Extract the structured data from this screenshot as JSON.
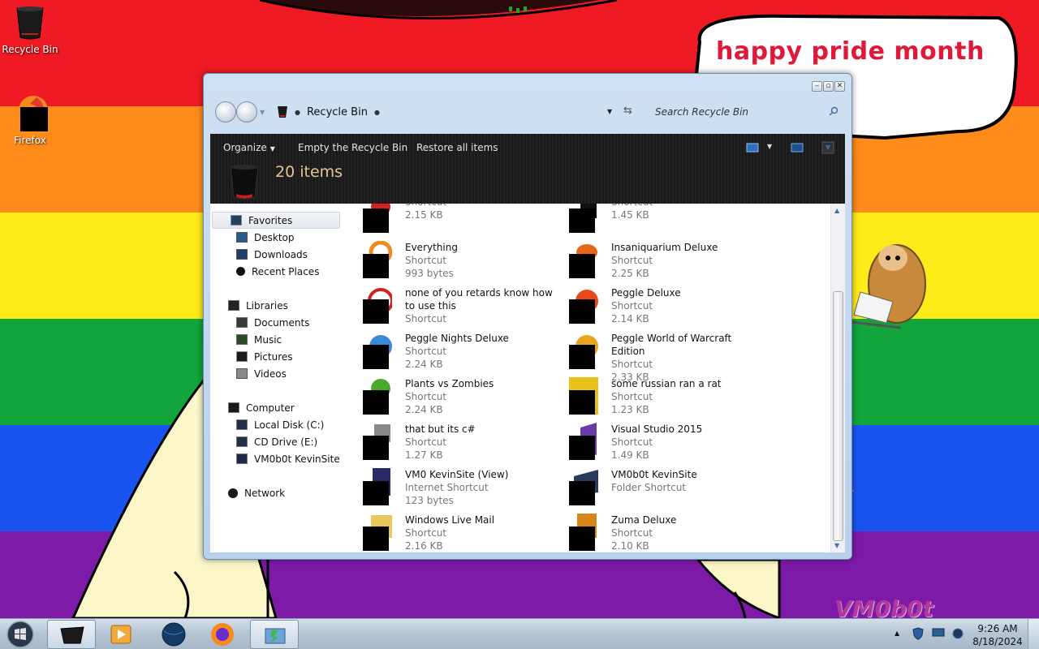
{
  "desktop": {
    "icons": [
      {
        "label": "Recycle Bin",
        "icon": "recycle-bin-icon"
      },
      {
        "label": "Firefox",
        "icon": "firefox-icon"
      }
    ],
    "speech_text": "happy pride month",
    "watermark": "VM0b0t"
  },
  "window": {
    "title_controls": [
      "minimize",
      "maximize",
      "close"
    ],
    "address": {
      "location": "Recycle Bin"
    },
    "search": {
      "placeholder": "Search Recycle Bin"
    },
    "toolbar": {
      "organize": "Organize",
      "empty": "Empty the Recycle Bin",
      "restore": "Restore all items"
    },
    "item_count": "20 items",
    "nav_pane": [
      {
        "label": "Favorites",
        "level": "top",
        "icon": "star-icon",
        "selected": true
      },
      {
        "label": "Desktop",
        "level": "sub",
        "icon": "desktop-icon"
      },
      {
        "label": "Downloads",
        "level": "sub",
        "icon": "downloads-icon"
      },
      {
        "label": "Recent Places",
        "level": "sub",
        "icon": "recent-places-icon"
      },
      {
        "label": "Libraries",
        "level": "top",
        "icon": "libraries-icon"
      },
      {
        "label": "Documents",
        "level": "sub",
        "icon": "documents-icon"
      },
      {
        "label": "Music",
        "level": "sub",
        "icon": "music-icon"
      },
      {
        "label": "Pictures",
        "level": "sub",
        "icon": "pictures-icon"
      },
      {
        "label": "Videos",
        "level": "sub",
        "icon": "videos-icon"
      },
      {
        "label": "Computer",
        "level": "top",
        "icon": "computer-icon"
      },
      {
        "label": "Local Disk (C:)",
        "level": "sub",
        "icon": "local-disk-icon"
      },
      {
        "label": "CD Drive (E:)",
        "level": "sub",
        "icon": "cd-drive-icon"
      },
      {
        "label": "VM0b0t KevinSite",
        "level": "sub",
        "icon": "folder-shortcut-icon"
      },
      {
        "label": "Network",
        "level": "top",
        "icon": "network-icon"
      }
    ],
    "files": [
      {
        "name": "",
        "type": "Shortcut",
        "size": "2.15 KB",
        "color": "#d42020"
      },
      {
        "name": "",
        "type": "Shortcut",
        "size": "1.45 KB",
        "color": "#111111"
      },
      {
        "name": "Everything",
        "type": "Shortcut",
        "size": "993 bytes",
        "color": "#f08a1a"
      },
      {
        "name": "Insaniquarium Deluxe",
        "type": "Shortcut",
        "size": "2.25 KB",
        "color": "#e8661a"
      },
      {
        "name": "none of you retards know how to use this",
        "type": "Shortcut",
        "size": "",
        "color": "#d42020"
      },
      {
        "name": "Peggle Deluxe",
        "type": "Shortcut",
        "size": "2.14 KB",
        "color": "#e84a1a"
      },
      {
        "name": "Peggle Nights Deluxe",
        "type": "Shortcut",
        "size": "2.24 KB",
        "color": "#3a8ad8"
      },
      {
        "name": "Peggle World of Warcraft Edition",
        "type": "Shortcut",
        "size": "2.33 KB",
        "color": "#e8a61a"
      },
      {
        "name": "Plants vs Zombies",
        "type": "Shortcut",
        "size": "2.24 KB",
        "color": "#4aa82a"
      },
      {
        "name": "some russian ran a rat",
        "type": "Shortcut",
        "size": "1.23 KB",
        "color": "#e8c21a"
      },
      {
        "name": "that but its c#",
        "type": "Shortcut",
        "size": "1.27 KB",
        "color": "#888888"
      },
      {
        "name": "Visual Studio 2015",
        "type": "Shortcut",
        "size": "1.49 KB",
        "color": "#6a3aa8"
      },
      {
        "name": "VM0 KevinSite (View)",
        "type": "Internet Shortcut",
        "size": "123 bytes",
        "color": "#2a2a6a"
      },
      {
        "name": "VM0b0t KevinSite",
        "type": "Folder Shortcut",
        "size": "",
        "color": "#2a3a5a"
      },
      {
        "name": "Windows Live Mail",
        "type": "Shortcut",
        "size": "2.16 KB",
        "color": "#e8c85a"
      },
      {
        "name": "Zuma Deluxe",
        "type": "Shortcut",
        "size": "2.10 KB",
        "color": "#d8861a"
      }
    ]
  },
  "taskbar": {
    "tasks": [
      {
        "icon": "recycle-bin-task-icon",
        "active": true
      },
      {
        "icon": "media-player-icon",
        "active": false
      },
      {
        "icon": "browser-globe-icon",
        "active": false
      },
      {
        "icon": "firefox-task-icon",
        "active": false
      },
      {
        "icon": "explorer-task-icon",
        "active": true
      }
    ],
    "clock": {
      "time": "9:26 AM",
      "date": "8/18/2024"
    }
  }
}
